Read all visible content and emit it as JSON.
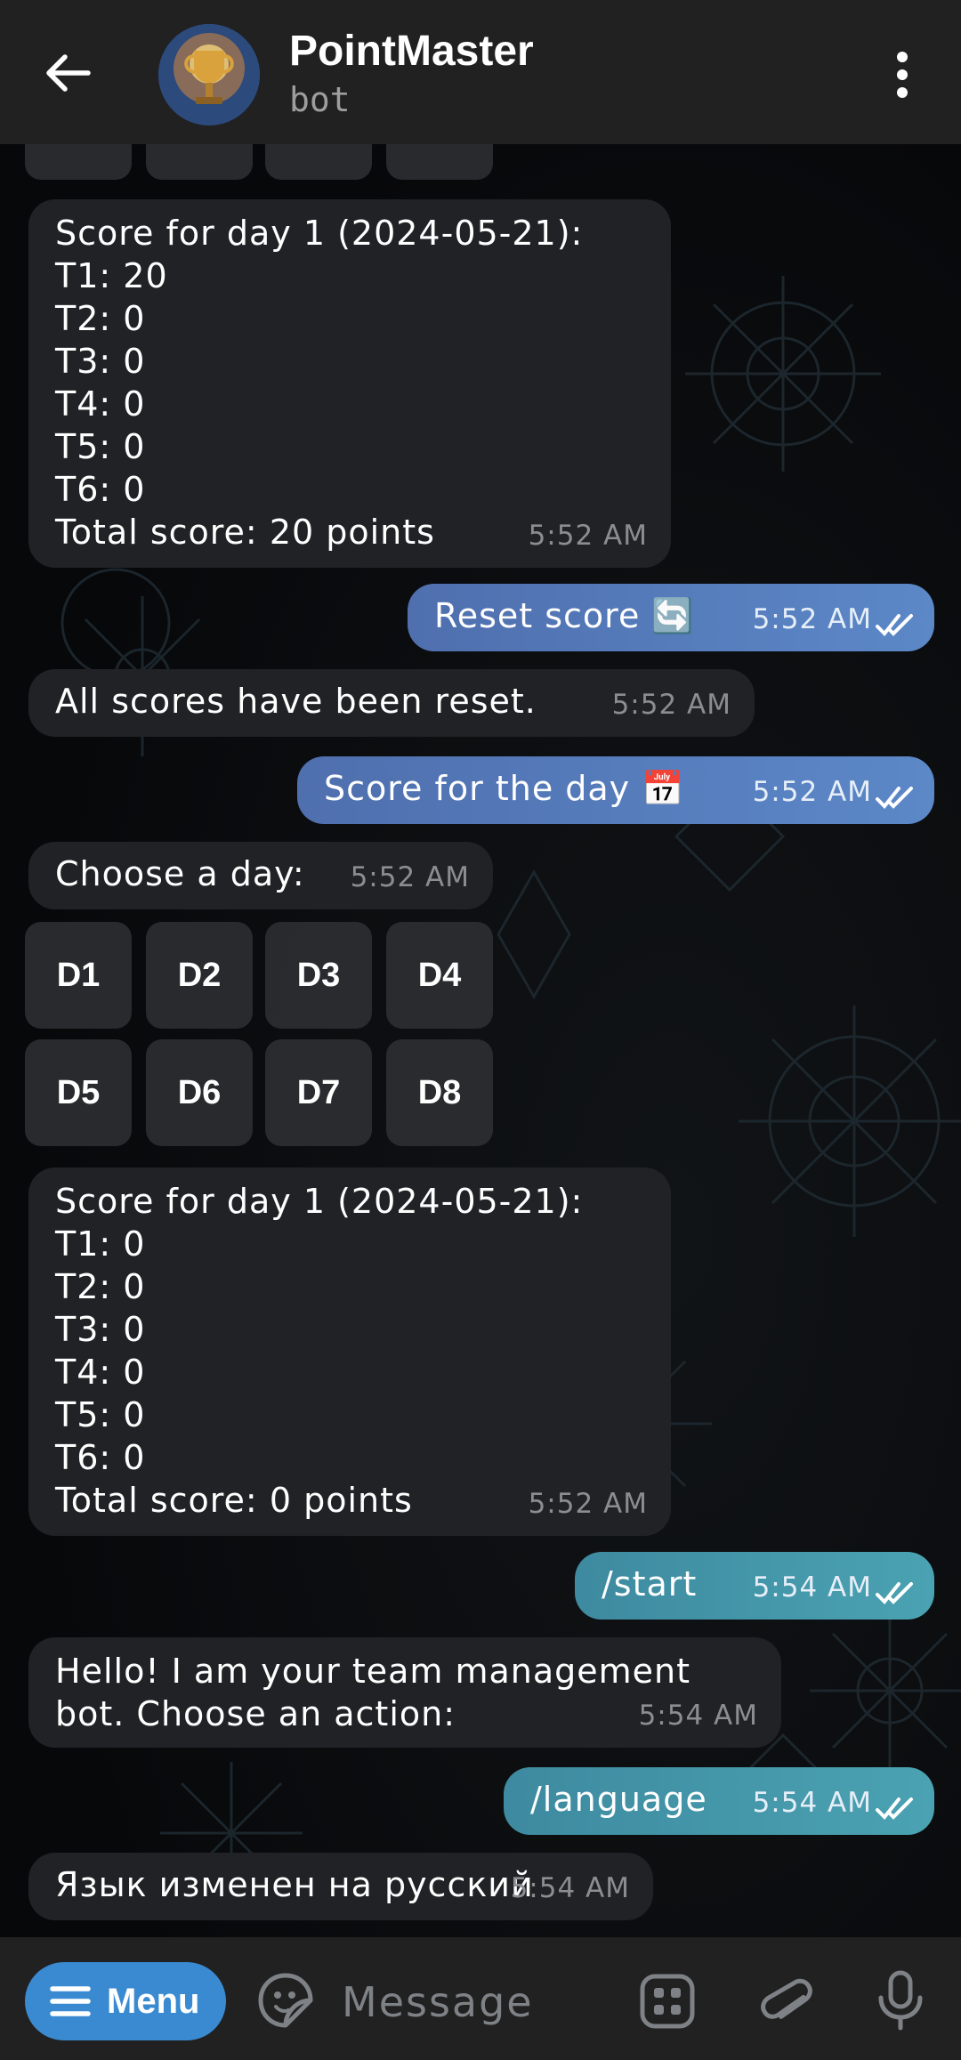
{
  "header": {
    "title": "PointMaster",
    "subtitle": "bot",
    "back_icon": "arrow-left-icon",
    "more_icon": "more-vertical-icon"
  },
  "colors": {
    "header_bg": "#212121",
    "incoming_bubble": "#212225",
    "outgoing_bubble": "#5a82c2",
    "outgoing_bubble_teal": "#45a0b0",
    "menu_button": "#3a8ad1",
    "timestamp_incoming": "#8a8d91"
  },
  "messages": [
    {
      "id": "m1",
      "direction": "incoming",
      "text": "Score for day 1 (2024-05-21):\nT1: 20\nT2: 0\nT3: 0\nT4: 0\nT5: 0\nT6: 0\nTotal score: 20 points",
      "time": "5:52 AM"
    },
    {
      "id": "m2",
      "direction": "outgoing",
      "text": "Reset score 🔄",
      "time": "5:52 AM"
    },
    {
      "id": "m3",
      "direction": "incoming",
      "text": "All scores have been reset.",
      "time": "5:52 AM"
    },
    {
      "id": "m4",
      "direction": "outgoing",
      "text": "Score for the day 📅",
      "time": "5:52 AM"
    },
    {
      "id": "m5",
      "direction": "incoming",
      "text": "Choose a day:",
      "time": "5:52 AM"
    },
    {
      "id": "m6",
      "direction": "incoming",
      "text": "Score for day 1 (2024-05-21):\nT1: 0\nT2: 0\nT3: 0\nT4: 0\nT5: 0\nT6: 0\nTotal score: 0 points",
      "time": "5:52 AM"
    },
    {
      "id": "m7",
      "direction": "outgoing",
      "text": "/start",
      "time": "5:54 AM"
    },
    {
      "id": "m8",
      "direction": "incoming",
      "text": "Hello! I am your team management\nbot. Choose an action:",
      "time": "5:54 AM"
    },
    {
      "id": "m9",
      "direction": "outgoing",
      "text": "/language",
      "time": "5:54 AM"
    },
    {
      "id": "m10",
      "direction": "incoming",
      "text": "Язык изменен на русский",
      "time": "5:54 AM"
    }
  ],
  "day_keyboard": [
    "D1",
    "D2",
    "D3",
    "D4",
    "D5",
    "D6",
    "D7",
    "D8"
  ],
  "bottom_bar": {
    "menu_label": "Menu",
    "menu_icon": "hamburger-icon",
    "sticker_icon": "sticker-icon",
    "input_placeholder": "Message",
    "apps_icon": "apps-grid-icon",
    "attach_icon": "paperclip-icon",
    "mic_icon": "microphone-icon"
  }
}
